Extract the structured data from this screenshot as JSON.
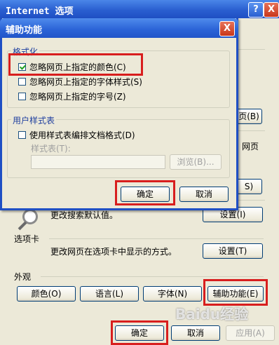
{
  "outer": {
    "title": "Internet 选项",
    "help": "?",
    "close": "X",
    "partial_btn1": "页(B)",
    "partial_text": "网页",
    "partial_btn2": "S)",
    "search_desc": "更改搜索默认值。",
    "search_settings": "设置(I)",
    "tabs_label": "选项卡",
    "tabs_desc": "更改网页在选项卡中显示的方式。",
    "tabs_settings": "设置(T)",
    "appearance_label": "外观",
    "colors_btn": "颜色(O)",
    "languages_btn": "语言(L)",
    "fonts_btn": "字体(N)",
    "accessibility_btn": "辅助功能(E)",
    "ok_btn": "确定",
    "cancel_btn": "取消",
    "apply_btn": "应用(A)",
    "watermark": "Baidu经验"
  },
  "dialog": {
    "title": "辅助功能",
    "close": "X",
    "format_group": "格式化",
    "opt_colors": "忽略网页上指定的颜色(C)",
    "opt_fonts": "忽略网页上指定的字体样式(S)",
    "opt_fontsize": "忽略网页上指定的字号(Z)",
    "user_style_group": "用户样式表",
    "opt_use_style": "使用样式表编排文档格式(D)",
    "stylesheet_label": "样式表(T):",
    "browse_btn": "浏览(B)...",
    "ok_btn": "确定",
    "cancel_btn": "取消"
  },
  "state": {
    "opt_colors_checked": true,
    "opt_fonts_checked": false,
    "opt_fontsize_checked": false,
    "opt_use_style_checked": false
  }
}
